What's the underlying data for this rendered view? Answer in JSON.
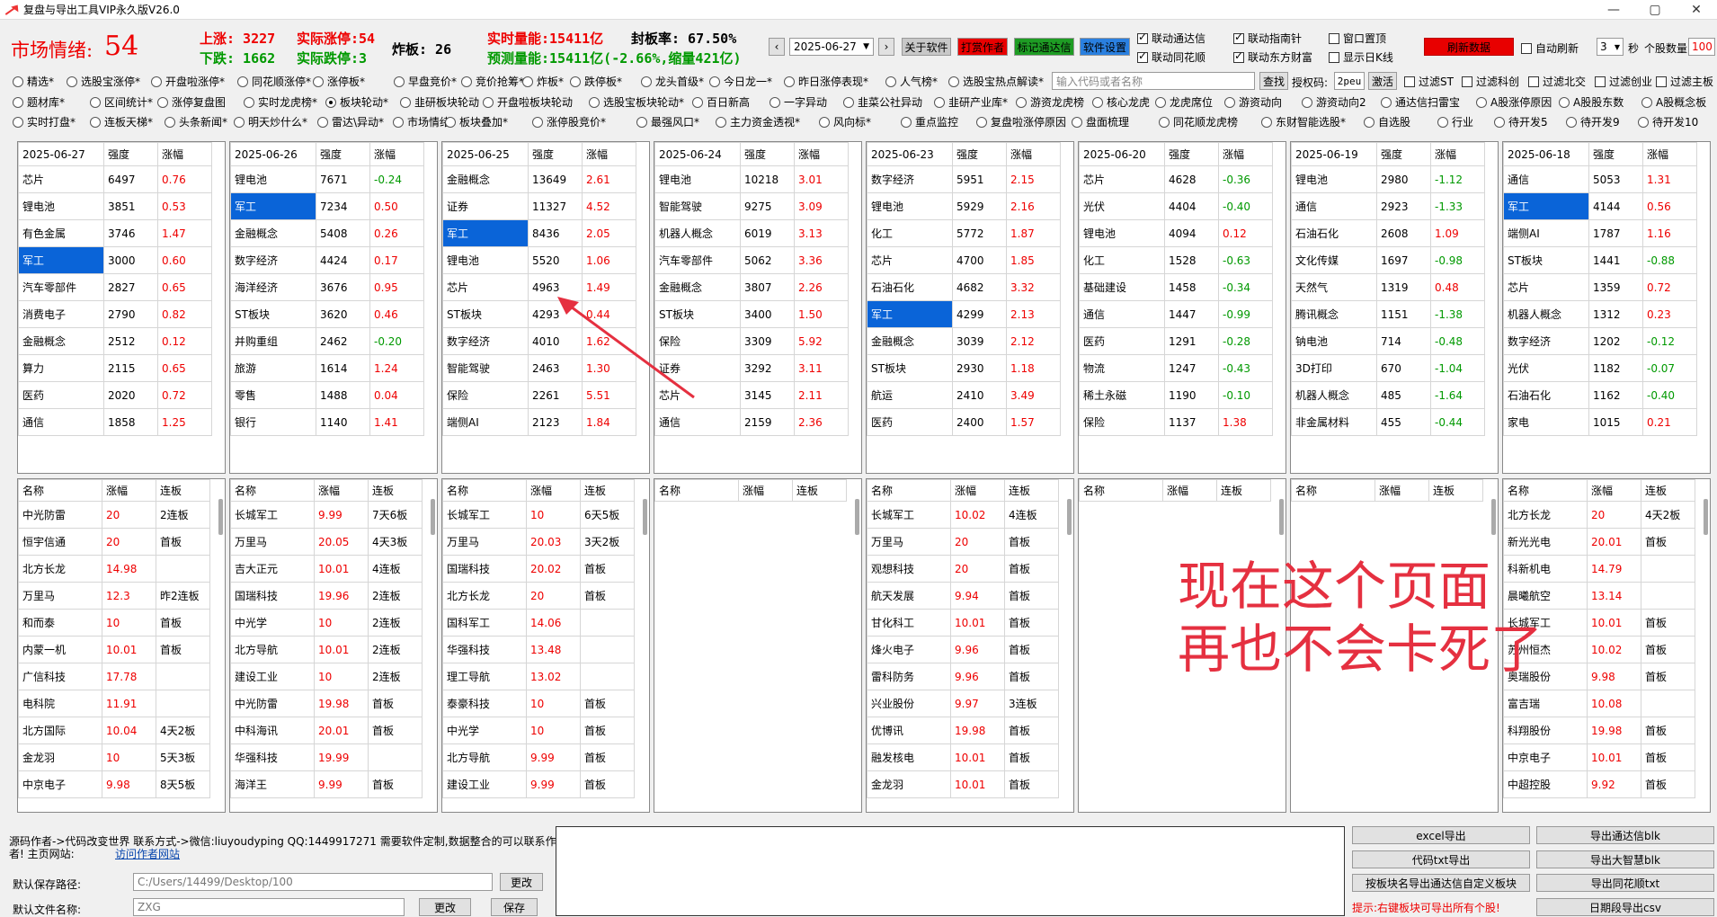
{
  "window": {
    "title": "复盘与导出工具VIP永久版V26.0",
    "controls": [
      "—",
      "▢",
      "✕"
    ]
  },
  "stats": {
    "sentiment_label": "市场情绪:",
    "sentiment_value": "54",
    "up_limit": "上涨:  3227",
    "actual_up": "实际涨停:54",
    "down_limit": "下跌:  1662",
    "actual_down": "实际跌停:3",
    "broken": "炸板:  26",
    "realtime_volume": "实时量能:15411亿",
    "seal_rate": "封板率:  67.50%",
    "predicted_volume": "预测量能:15411亿(-2.66%,缩量421亿)"
  },
  "toolbar": {
    "prev": "‹",
    "date": "2025-06-27",
    "next": "›",
    "about": "关于软件",
    "donate": "打赏作者",
    "mark_tdx": "标记通达信",
    "settings": "软件设置",
    "link_tdx": "联动通达信",
    "link_compass": "联动指南针",
    "window_top": "窗口置顶",
    "link_ths": "联动同花顺",
    "link_dfcf": "联动东方财富",
    "show_kline": "显示日K线",
    "refresh": "刷新数据",
    "auto_refresh": "自动刷新",
    "interval": "3",
    "sec": "秒",
    "count_label": "个股数量",
    "count": "100"
  },
  "options": {
    "row1": [
      "精选*",
      "选股宝涨停*",
      "开盘啦涨停*",
      "同花顺涨停*",
      "涨停板*",
      "早盘竞价*",
      "竞价抢筹*",
      "炸板*",
      "跌停板*",
      "龙头首级*",
      "今日龙一*",
      "昨日涨停表现*",
      "人气榜*",
      "选股宝热点解读*"
    ],
    "search_placeholder": "输入代码或者名称",
    "search_btn": "查找",
    "auth_label": "授权码:",
    "auth_value": "2peu",
    "activate": "激活",
    "filters": [
      "过滤ST",
      "过滤科创",
      "过滤北交",
      "过滤创业",
      "过滤主板"
    ],
    "row2": [
      "题材库*",
      "区间统计*",
      "涨停复盘图",
      "实时龙虎榜*",
      "板块轮动*",
      "韭研板块轮动",
      "开盘啦板块轮动",
      "选股宝板块轮动*",
      "百日新高",
      "一字异动",
      "韭菜公社异动",
      "韭研产业库*",
      "游资龙虎榜",
      "核心龙虎",
      "龙虎席位",
      "游资动向",
      "游资动向2",
      "通达信扫雷宝",
      "A股涨停原因",
      "A股股东数",
      "A股概念板"
    ],
    "row3": [
      "实时打盘*",
      "连板天梯*",
      "头条新闻*",
      "明天炒什么*",
      "雷达\\异动*",
      "市场情绪",
      "板块叠加*",
      "涨停股竞价*",
      "最强风口*",
      "主力资金透视*",
      "风向标*",
      "重点监控",
      "复盘啦涨停原因",
      "盘面梳理",
      "同花顺龙虎榜",
      "东财智能选股*",
      "自选股",
      "行业",
      "待开发5",
      "待开发9",
      "待开发10"
    ]
  },
  "sector_headers": [
    "强度",
    "涨幅"
  ],
  "sectors": [
    {
      "date": "2025-06-27",
      "rows": [
        [
          "芯片",
          "6497",
          "0.76"
        ],
        [
          "锂电池",
          "3851",
          "0.53"
        ],
        [
          "有色金属",
          "3746",
          "1.47"
        ],
        [
          "军工",
          "3000",
          "0.60"
        ],
        [
          "汽车零部件",
          "2827",
          "0.65"
        ],
        [
          "消费电子",
          "2790",
          "0.82"
        ],
        [
          "金融概念",
          "2512",
          "0.12"
        ],
        [
          "算力",
          "2115",
          "0.65"
        ],
        [
          "医药",
          "2020",
          "0.72"
        ],
        [
          "通信",
          "1858",
          "1.25"
        ]
      ],
      "sel": 3
    },
    {
      "date": "2025-06-26",
      "rows": [
        [
          "锂电池",
          "7671",
          "-0.24"
        ],
        [
          "军工",
          "7234",
          "0.50"
        ],
        [
          "金融概念",
          "5408",
          "0.26"
        ],
        [
          "数字经济",
          "4424",
          "0.17"
        ],
        [
          "海洋经济",
          "3676",
          "0.95"
        ],
        [
          "ST板块",
          "3620",
          "0.46"
        ],
        [
          "并购重组",
          "2462",
          "-0.20"
        ],
        [
          "旅游",
          "1614",
          "1.24"
        ],
        [
          "零售",
          "1488",
          "0.04"
        ],
        [
          "银行",
          "1140",
          "1.41"
        ]
      ],
      "sel": 1
    },
    {
      "date": "2025-06-25",
      "rows": [
        [
          "金融概念",
          "13649",
          "2.61"
        ],
        [
          "证券",
          "11327",
          "4.52"
        ],
        [
          "军工",
          "8436",
          "2.05"
        ],
        [
          "锂电池",
          "5520",
          "1.06"
        ],
        [
          "芯片",
          "4963",
          "1.49"
        ],
        [
          "ST板块",
          "4293",
          "0.44"
        ],
        [
          "数字经济",
          "4010",
          "1.62"
        ],
        [
          "智能驾驶",
          "2463",
          "1.30"
        ],
        [
          "保险",
          "2261",
          "5.51"
        ],
        [
          "端侧AI",
          "2123",
          "1.84"
        ]
      ],
      "sel": 2
    },
    {
      "date": "2025-06-24",
      "rows": [
        [
          "锂电池",
          "10218",
          "3.01"
        ],
        [
          "智能驾驶",
          "9275",
          "3.09"
        ],
        [
          "机器人概念",
          "6019",
          "3.13"
        ],
        [
          "汽车零部件",
          "5062",
          "3.36"
        ],
        [
          "金融概念",
          "3807",
          "2.26"
        ],
        [
          "ST板块",
          "3400",
          "1.50"
        ],
        [
          "保险",
          "3309",
          "5.92"
        ],
        [
          "证券",
          "3292",
          "3.11"
        ],
        [
          "芯片",
          "3145",
          "2.11"
        ],
        [
          "通信",
          "2159",
          "2.36"
        ]
      ],
      "sel": -1
    },
    {
      "date": "2025-06-23",
      "rows": [
        [
          "数字经济",
          "5951",
          "2.15"
        ],
        [
          "锂电池",
          "5929",
          "2.16"
        ],
        [
          "化工",
          "5772",
          "1.87"
        ],
        [
          "芯片",
          "4700",
          "1.85"
        ],
        [
          "石油石化",
          "4682",
          "3.32"
        ],
        [
          "军工",
          "4299",
          "2.13"
        ],
        [
          "金融概念",
          "3039",
          "2.12"
        ],
        [
          "ST板块",
          "2930",
          "1.18"
        ],
        [
          "航运",
          "2410",
          "3.49"
        ],
        [
          "医药",
          "2400",
          "1.57"
        ]
      ],
      "sel": 5
    },
    {
      "date": "2025-06-20",
      "rows": [
        [
          "芯片",
          "4628",
          "-0.36"
        ],
        [
          "光伏",
          "4404",
          "-0.40"
        ],
        [
          "锂电池",
          "4094",
          "0.12"
        ],
        [
          "化工",
          "1528",
          "-0.63"
        ],
        [
          "基础建设",
          "1458",
          "-0.34"
        ],
        [
          "通信",
          "1447",
          "-0.99"
        ],
        [
          "医药",
          "1291",
          "-0.28"
        ],
        [
          "物流",
          "1247",
          "-0.43"
        ],
        [
          "稀土永磁",
          "1190",
          "-0.10"
        ],
        [
          "保险",
          "1137",
          "1.38"
        ]
      ],
      "sel": -1
    },
    {
      "date": "2025-06-19",
      "rows": [
        [
          "锂电池",
          "2980",
          "-1.12"
        ],
        [
          "通信",
          "2923",
          "-1.33"
        ],
        [
          "石油石化",
          "2608",
          "1.09"
        ],
        [
          "文化传媒",
          "1697",
          "-0.98"
        ],
        [
          "天然气",
          "1319",
          "0.48"
        ],
        [
          "腾讯概念",
          "1151",
          "-1.38"
        ],
        [
          "钠电池",
          "714",
          "-0.48"
        ],
        [
          "3D打印",
          "670",
          "-1.04"
        ],
        [
          "机器人概念",
          "485",
          "-1.64"
        ],
        [
          "非金属材料",
          "455",
          "-0.44"
        ]
      ],
      "sel": -1
    },
    {
      "date": "2025-06-18",
      "rows": [
        [
          "通信",
          "5053",
          "1.31"
        ],
        [
          "军工",
          "4144",
          "0.56"
        ],
        [
          "端侧AI",
          "1787",
          "1.16"
        ],
        [
          "ST板块",
          "1441",
          "-0.88"
        ],
        [
          "芯片",
          "1359",
          "0.72"
        ],
        [
          "机器人概念",
          "1312",
          "0.23"
        ],
        [
          "数字经济",
          "1202",
          "-0.12"
        ],
        [
          "光伏",
          "1182",
          "-0.07"
        ],
        [
          "石油石化",
          "1162",
          "-0.40"
        ],
        [
          "家电",
          "1015",
          "0.21"
        ]
      ],
      "sel": 1
    }
  ],
  "stock_headers": [
    "名称",
    "涨幅",
    "连板"
  ],
  "stocks": [
    [
      [
        "中光防雷",
        "20",
        "2连板"
      ],
      [
        "恒宇信通",
        "20",
        "首板"
      ],
      [
        "北方长龙",
        "14.98",
        ""
      ],
      [
        "万里马",
        "12.3",
        "昨2连板"
      ],
      [
        "和而泰",
        "10",
        "首板"
      ],
      [
        "内蒙一机",
        "10.01",
        "首板"
      ],
      [
        "广信科技",
        "17.78",
        ""
      ],
      [
        "电科院",
        "11.91",
        ""
      ],
      [
        "北方国际",
        "10.04",
        "4天2板"
      ],
      [
        "金龙羽",
        "10",
        "5天3板"
      ],
      [
        "中京电子",
        "9.98",
        "8天5板"
      ]
    ],
    [
      [
        "长城军工",
        "9.99",
        "7天6板"
      ],
      [
        "万里马",
        "20.05",
        "4天3板"
      ],
      [
        "吉大正元",
        "10.01",
        "4连板"
      ],
      [
        "国瑞科技",
        "19.96",
        "2连板"
      ],
      [
        "中光学",
        "10",
        "2连板"
      ],
      [
        "北方导航",
        "10.01",
        "2连板"
      ],
      [
        "建设工业",
        "10",
        "2连板"
      ],
      [
        "中光防雷",
        "19.98",
        "首板"
      ],
      [
        "中科海讯",
        "20.01",
        "首板"
      ],
      [
        "华强科技",
        "19.99",
        ""
      ],
      [
        "海洋王",
        "9.99",
        "首板"
      ]
    ],
    [
      [
        "长城军工",
        "10",
        "6天5板"
      ],
      [
        "万里马",
        "20.03",
        "3天2板"
      ],
      [
        "国瑞科技",
        "20.02",
        "首板"
      ],
      [
        "北方长龙",
        "20",
        "首板"
      ],
      [
        "国科军工",
        "14.06",
        ""
      ],
      [
        "华强科技",
        "13.48",
        ""
      ],
      [
        "理工导航",
        "13.02",
        ""
      ],
      [
        "泰豪科技",
        "10",
        "首板"
      ],
      [
        "中光学",
        "10",
        "首板"
      ],
      [
        "北方导航",
        "9.99",
        "首板"
      ],
      [
        "建设工业",
        "9.99",
        "首板"
      ]
    ],
    [],
    [
      [
        "长城军工",
        "10.02",
        "4连板"
      ],
      [
        "万里马",
        "20",
        "首板"
      ],
      [
        "观想科技",
        "20",
        "首板"
      ],
      [
        "航天发展",
        "9.94",
        "首板"
      ],
      [
        "甘化科工",
        "10.01",
        "首板"
      ],
      [
        "烽火电子",
        "9.96",
        "首板"
      ],
      [
        "雷科防务",
        "9.96",
        "首板"
      ],
      [
        "兴业股份",
        "9.97",
        "3连板"
      ],
      [
        "优博讯",
        "19.98",
        "首板"
      ],
      [
        "融发核电",
        "10.01",
        "首板"
      ],
      [
        "金龙羽",
        "10.01",
        "首板"
      ]
    ],
    [],
    [],
    [
      [
        "北方长龙",
        "20",
        "4天2板"
      ],
      [
        "新光光电",
        "20.01",
        "首板"
      ],
      [
        "科新机电",
        "14.79",
        ""
      ],
      [
        "晨曦航空",
        "13.14",
        ""
      ],
      [
        "长城军工",
        "10.01",
        "首板"
      ],
      [
        "苏州恒杰",
        "10.02",
        "首板"
      ],
      [
        "奥瑞股份",
        "9.98",
        "首板"
      ],
      [
        "富吉瑞",
        "10.08",
        ""
      ],
      [
        "科翔股份",
        "19.98",
        "首板"
      ],
      [
        "中京电子",
        "10.01",
        "首板"
      ],
      [
        "中超控股",
        "9.92",
        "首板"
      ]
    ]
  ],
  "overlay": {
    "line1": "现在这个页面",
    "line2": "再也不会卡死了"
  },
  "bottom": {
    "author_line1": "源码作者->代码改变世界 联系方式->微信:liuyoudyping QQ:1449917271 需要软件定制,数据整合的可以联系作",
    "author_line2": "者! 主页网站:",
    "website": "访问作者网站",
    "save_path_label": "默认保存路径:",
    "save_path": "C:/Users/14499/Desktop/100",
    "change": "更改",
    "file_name_label": "默认文件名称:",
    "file_name": "ZXG",
    "change2": "更改",
    "save": "保存",
    "exp_excel": "excel导出",
    "exp_tdx_blk": "导出通达信blk",
    "exp_code_txt": "代码txt导出",
    "exp_dzh_blk": "导出大智慧blk",
    "exp_sector_tdx": "按板块名导出通达信自定义板块",
    "exp_ths_txt": "导出同花顺txt",
    "hint": "提示:右键板块可导出所有个股!",
    "exp_daily_csv": "日期段导出csv"
  }
}
